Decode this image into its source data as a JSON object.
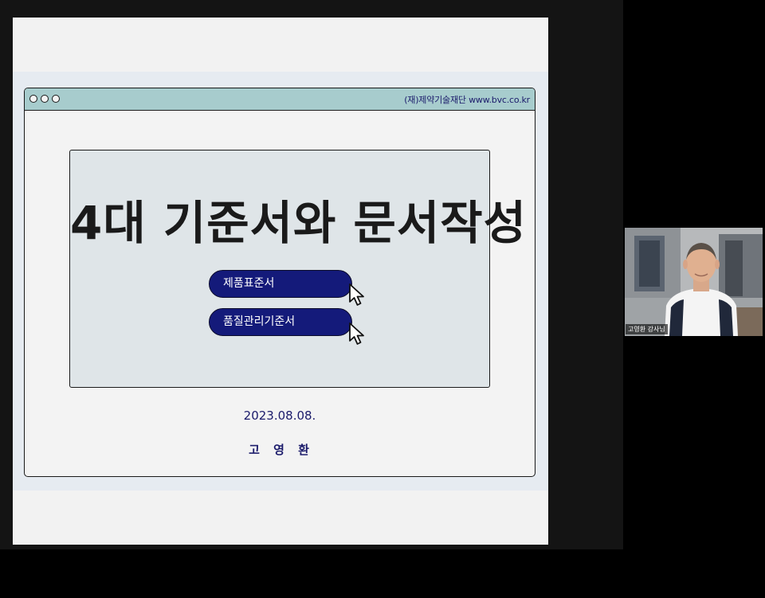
{
  "slide": {
    "header_text": "(재)제약기술재단  www.bvc.co.kr",
    "title": "4대 기준서와 문서작성",
    "buttons": [
      {
        "label": "제품표준서"
      },
      {
        "label": "품질관리기준서"
      }
    ],
    "date": "2023.08.08.",
    "author": "고 영 환"
  },
  "participant": {
    "name": "고영환 강사님"
  },
  "colors": {
    "browser_bar": "#a7cccd",
    "pill": "#141a7a",
    "accent_text": "#1b1b6b"
  }
}
